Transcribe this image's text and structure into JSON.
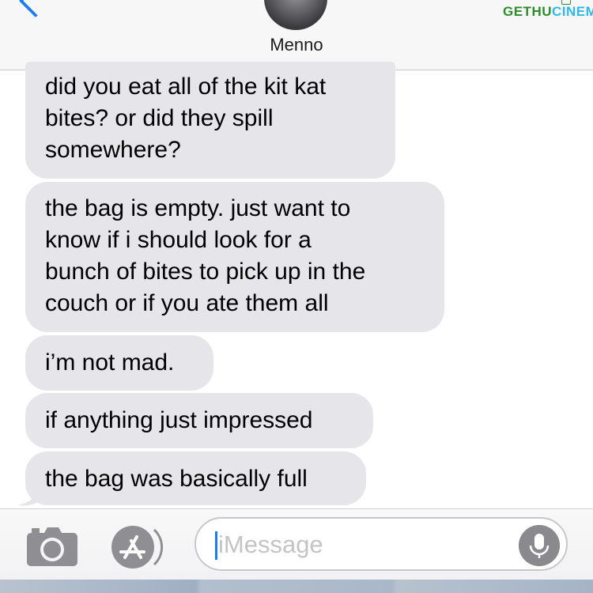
{
  "header": {
    "contact_name": "Menno",
    "watermark_part1": "GETHU",
    "watermark_part2": "CINEMA"
  },
  "messages": [
    {
      "sender": "Menno",
      "lines": [
        "did you eat all of the kit kat",
        "bites? or did they spill",
        "somewhere?"
      ]
    },
    {
      "sender": "Menno",
      "lines": [
        "the bag is empty. just want to",
        "know if i should look for a",
        "bunch of bites to pick up in the",
        "couch or if you ate them all"
      ]
    },
    {
      "sender": "Menno",
      "lines": [
        "i’m not mad."
      ]
    },
    {
      "sender": "Menno",
      "lines": [
        "if anything just impressed"
      ]
    },
    {
      "sender": "Menno",
      "lines": [
        "the bag was basically full"
      ]
    }
  ],
  "input_bar": {
    "placeholder": "iMessage",
    "camera_icon": "camera-icon",
    "apps_icon": "app-store-icon",
    "mic_icon": "microphone-icon"
  },
  "colors": {
    "accent": "#1a7cf5",
    "received_bubble": "#e5e5ea",
    "header_bg": "#f7f7f7"
  }
}
